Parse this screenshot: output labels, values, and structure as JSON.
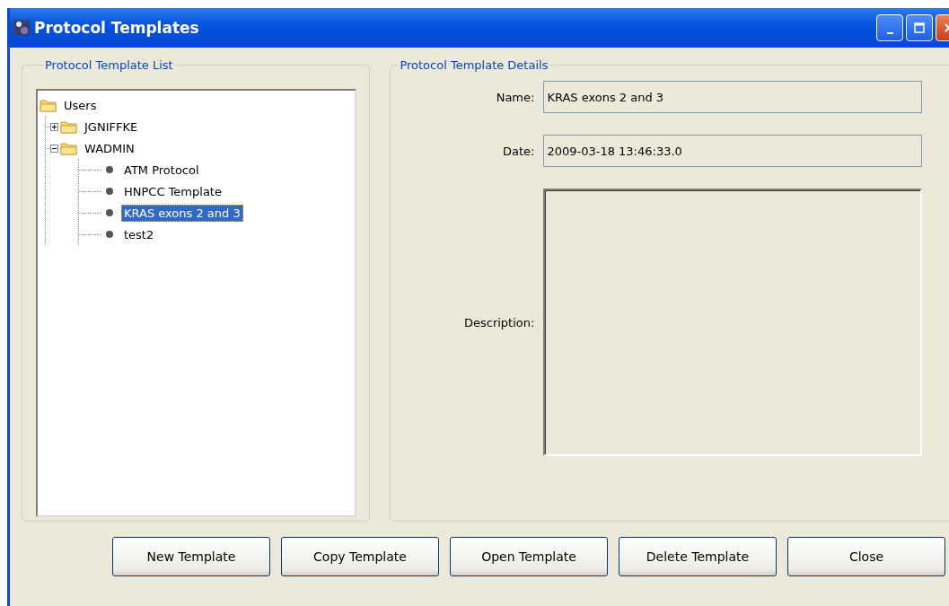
{
  "window": {
    "title": "Protocol Templates"
  },
  "template_list": {
    "title": "Protocol Template List",
    "tree": [
      {
        "label": "Users",
        "kind": "folder",
        "selected": false,
        "children": [
          {
            "label": "JGNIFFKE",
            "kind": "folder",
            "expanded": false,
            "selected": false
          },
          {
            "label": "WADMIN",
            "kind": "folder",
            "expanded": true,
            "selected": false,
            "children": [
              {
                "label": "ATM Protocol",
                "kind": "leaf",
                "selected": false
              },
              {
                "label": "HNPCC Template",
                "kind": "leaf",
                "selected": false
              },
              {
                "label": "KRAS exons 2 and 3",
                "kind": "leaf",
                "selected": true
              },
              {
                "label": "test2",
                "kind": "leaf",
                "selected": false
              }
            ]
          }
        ]
      }
    ]
  },
  "template_details": {
    "title": "Protocol Template Details",
    "fields": [
      {
        "label": "Name:",
        "value": "KRAS exons 2 and 3",
        "kind": "line"
      },
      {
        "label": "Date:",
        "value": "2009-03-18 13:46:33.0",
        "kind": "line"
      },
      {
        "label": "Description:",
        "kind": "area"
      }
    ]
  },
  "buttons": [
    "New Template",
    "Copy Template",
    "Open Template",
    "Delete Template",
    "Close"
  ]
}
